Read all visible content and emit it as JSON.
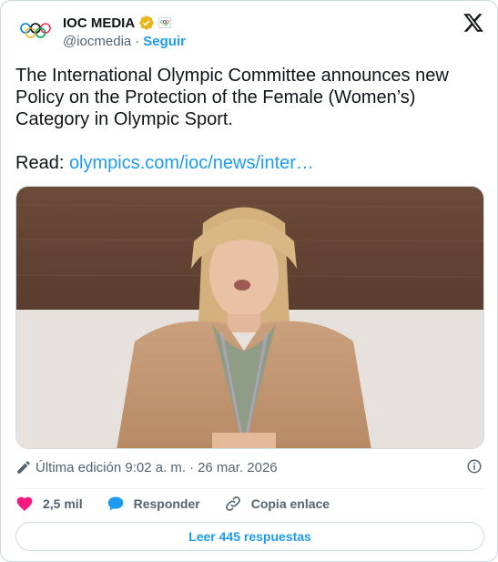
{
  "author": {
    "name": "IOC MEDIA",
    "handle": "@iocmedia",
    "separator": "·",
    "follow_label": "Seguir",
    "verified_color": "#e8b51c",
    "logo_icon": "olympic-rings-icon"
  },
  "tweet": {
    "text": "The International Olympic Committee announces new\nPolicy on the Protection of the Female (Women’s)\nCategory in Olympic Sport.",
    "read_prefix": "Read: ",
    "link_text": "olympics.com/ioc/news/inter…"
  },
  "meta": {
    "edited_label": "Última edición 9:02 a. m.",
    "separator": "·",
    "date": "26 mar. 2026"
  },
  "actions": {
    "likes_count": "2,5 mil",
    "reply_label": "Responder",
    "copy_link_label": "Copia enlace"
  },
  "replies_button": "Leer 445 respuestas",
  "colors": {
    "accent": "#1d9bf0",
    "heart": "#f91880",
    "text": "#0f1419",
    "muted": "#536471",
    "border": "#cfd9de"
  }
}
